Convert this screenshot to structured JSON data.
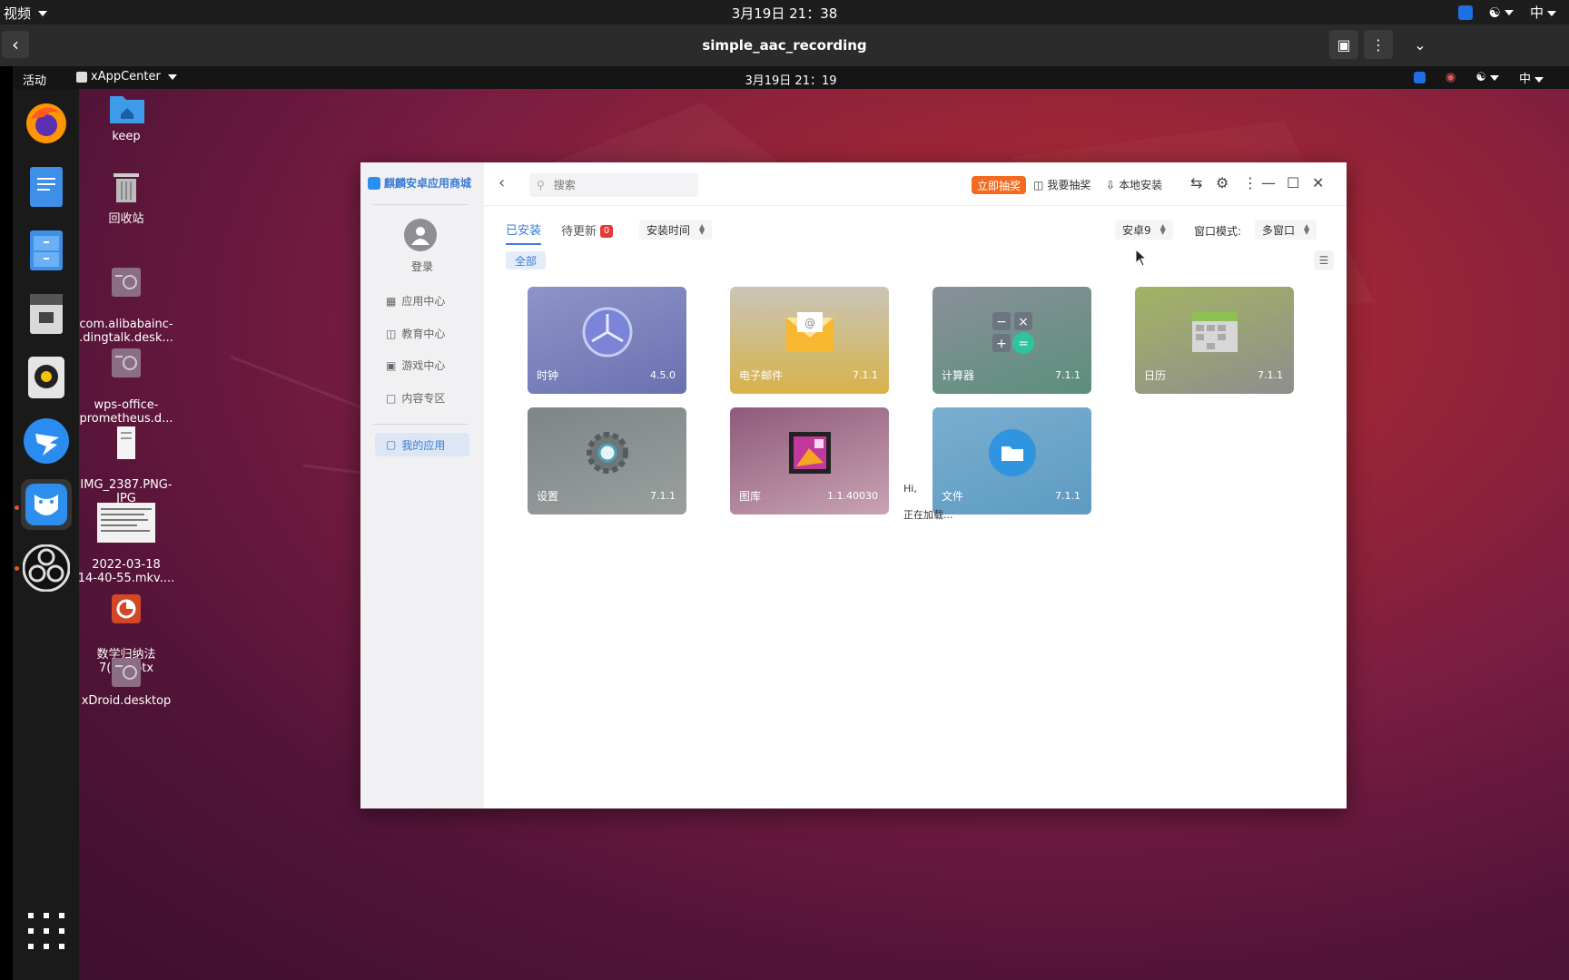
{
  "host": {
    "menu_label": "视频",
    "clock": "3月19日 21：38",
    "lang": "中",
    "title": "simple_aac_recording"
  },
  "guest": {
    "activities": "活动",
    "app_name": "xAppCenter",
    "clock": "3月19日 21：19",
    "lang": "中"
  },
  "desktop_icons": [
    {
      "label": "keep"
    },
    {
      "label": "回收站"
    },
    {
      "label": "com.alibabainc-\n.dingtalk.desk..."
    },
    {
      "label": "wps-office-\nprometheus.d..."
    },
    {
      "label": "IMG_2387.PNG-\nJPG"
    },
    {
      "label": "2022-03-18\n14-40-55.mkv...."
    },
    {
      "label": "数学归纳法\n7(1).pptx"
    },
    {
      "label": "xDroid.desktop"
    }
  ],
  "app": {
    "brand": "麒麟安卓应用商城",
    "login": "登录",
    "nav": [
      {
        "label": "应用中心"
      },
      {
        "label": "教育中心"
      },
      {
        "label": "游戏中心"
      },
      {
        "label": "内容专区"
      },
      {
        "label": "我的应用"
      }
    ],
    "search_placeholder": "搜索",
    "promo": "立即抽奖",
    "my_prizes": "我要抽奖",
    "local_install": "本地安装",
    "tabs": [
      {
        "label": "已安装"
      },
      {
        "label": "待更新"
      }
    ],
    "update_count": "0",
    "sort_select": "安装时间",
    "android_select": "安卓9",
    "window_mode_label": "窗口模式:",
    "window_mode_select": "多窗口",
    "filter_chip": "全部",
    "cards": [
      {
        "name": "时钟",
        "version": "4.5.0"
      },
      {
        "name": "电子邮件",
        "version": "7.1.1"
      },
      {
        "name": "计算器",
        "version": "7.1.1"
      },
      {
        "name": "日历",
        "version": "7.1.1"
      },
      {
        "name": "设置",
        "version": "7.1.1"
      },
      {
        "name": "图库",
        "version": "1.1.40030"
      },
      {
        "name": "文件",
        "version": "7.1.1"
      }
    ],
    "hi_text": "Hi,",
    "loading_text": "正在加载..."
  }
}
